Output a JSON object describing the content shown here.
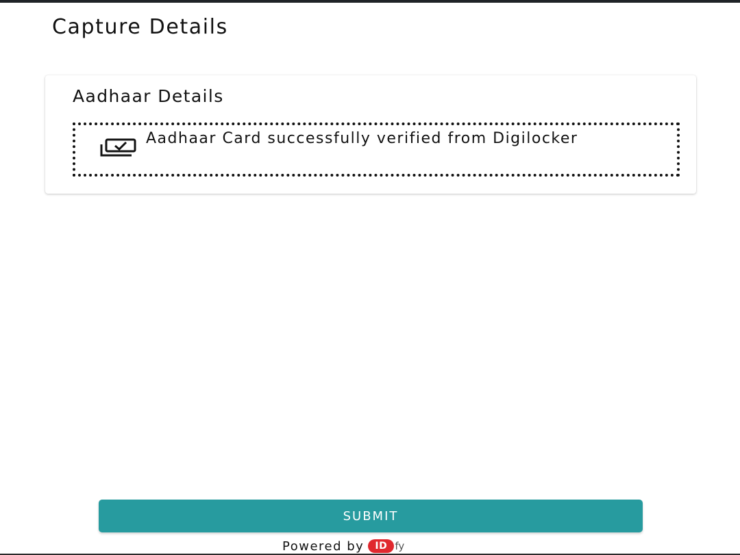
{
  "page": {
    "title": "Capture Details"
  },
  "aadhaar_card": {
    "title": "Aadhaar Details",
    "status_icon": "verified-document-icon",
    "status_message": "Aadhaar Card successfully verified from Digilocker"
  },
  "actions": {
    "submit_label": "SUBMIT"
  },
  "footer": {
    "powered_by_text": "Powered by",
    "brand_mark": "ID",
    "brand_suffix": "fy"
  },
  "colors": {
    "primary": "#279b9f",
    "brand": "#e0282e",
    "text": "#111111"
  }
}
